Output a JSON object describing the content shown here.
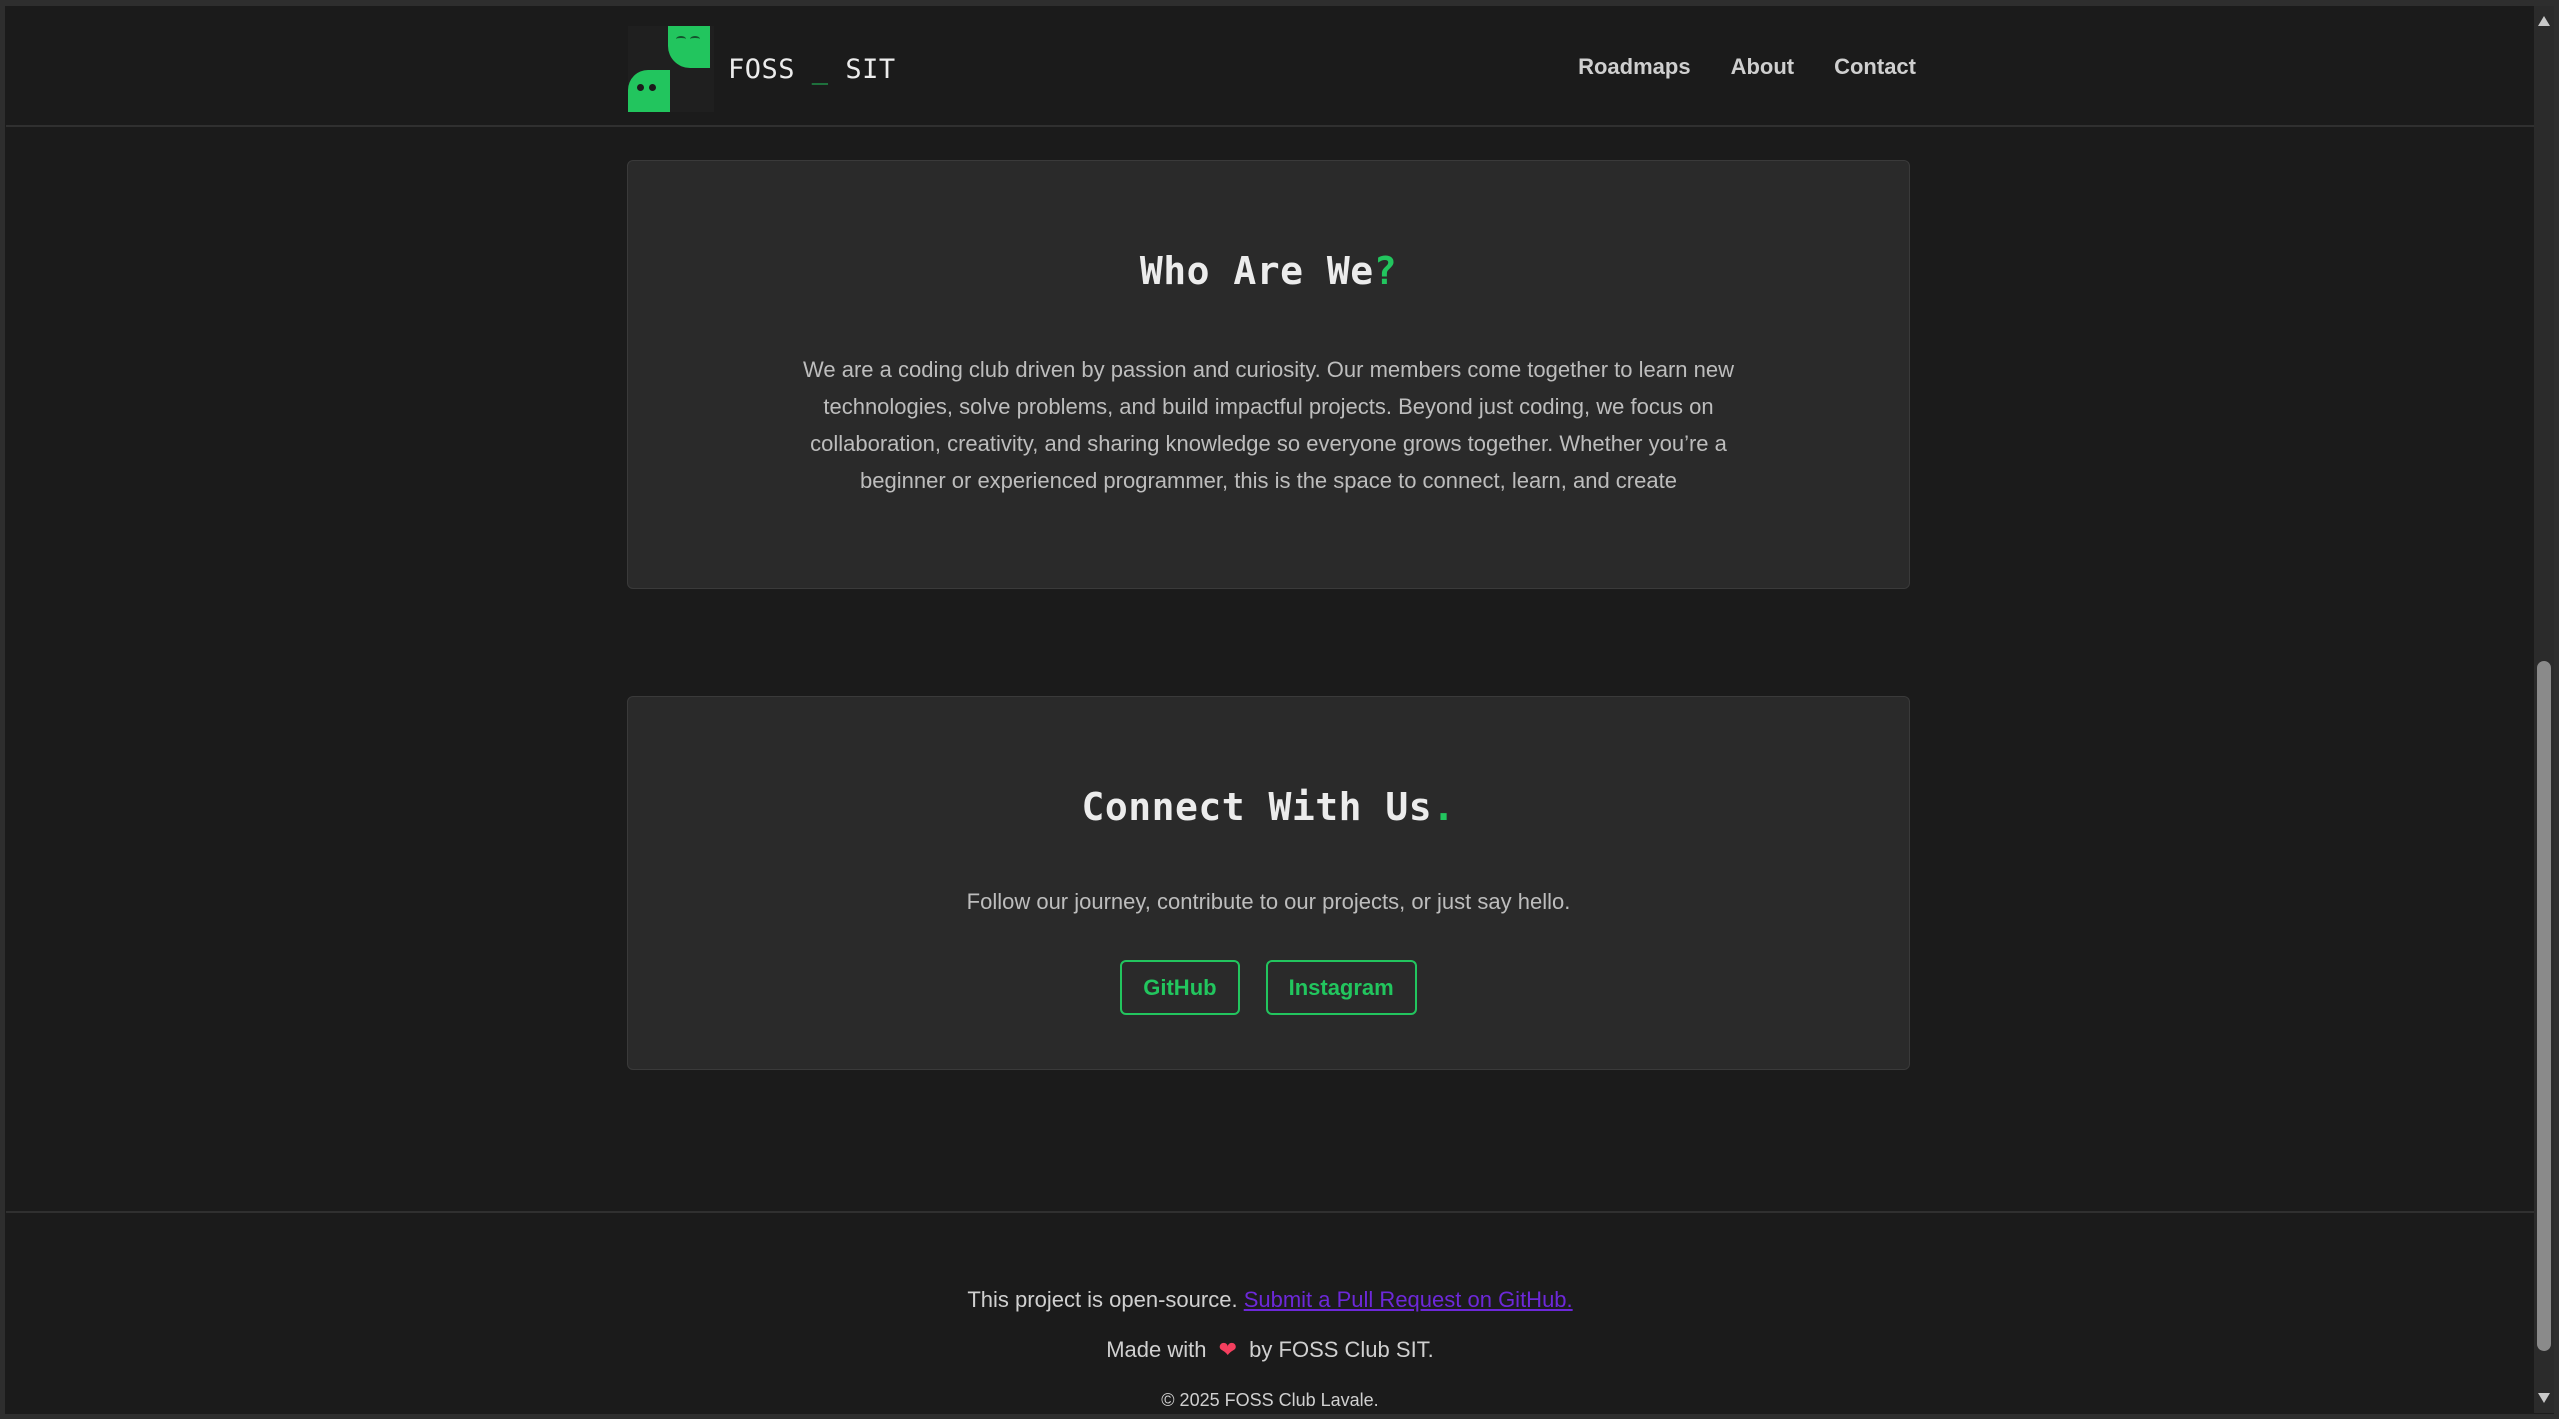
{
  "navbar": {
    "brand": {
      "name_part1": "FOSS",
      "name_sep": " _ ",
      "name_part2": "SIT"
    },
    "links": [
      {
        "label": "Roadmaps"
      },
      {
        "label": "About"
      },
      {
        "label": "Contact"
      }
    ]
  },
  "about": {
    "title": "Who Are We",
    "title_accent": "?",
    "body": "We are a coding club driven by passion and curiosity. Our members come together to learn new technologies, solve problems, and build impactful projects. Beyond just coding, we focus on collaboration, creativity, and sharing knowledge so everyone grows together. Whether you’re a beginner or experienced programmer, this is the space to connect, learn, and create"
  },
  "connect": {
    "title": "Connect With Us",
    "title_accent": ".",
    "body": "Follow our journey, contribute to our projects, or just say hello.",
    "buttons": [
      {
        "label": "GitHub"
      },
      {
        "label": "Instagram"
      }
    ]
  },
  "footer": {
    "open_source_text": "This project is open-source.",
    "pr_link": "Submit a Pull Request on GitHub.",
    "made_with_prefix": "Made with",
    "heart": "❤",
    "made_with_suffix": "by FOSS Club SIT.",
    "copyright": "© 2025 FOSS Club Lavale."
  },
  "colors": {
    "accent": "#22c55e",
    "background": "#1b1b1b",
    "card": "#2a2a2a",
    "link": "#6d28d9",
    "heart": "#f43f5e"
  }
}
